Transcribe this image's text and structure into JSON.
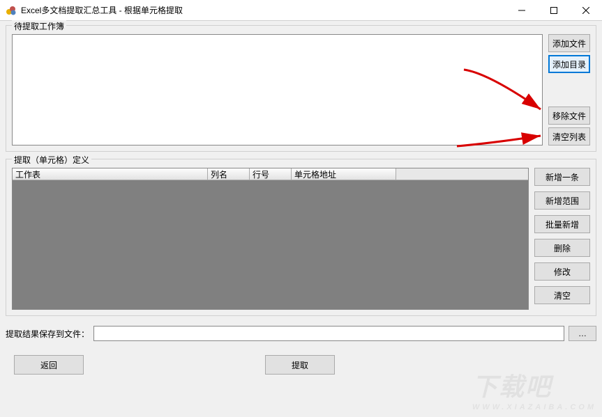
{
  "window": {
    "title": "Excel多文档提取汇总工具 - 根据单元格提取"
  },
  "group1": {
    "legend": "待提取工作簿",
    "buttons": {
      "add_file": "添加文件",
      "add_dir": "添加目录",
      "remove_file": "移除文件",
      "clear_list": "清空列表"
    }
  },
  "group2": {
    "legend": "提取（单元格）定义",
    "columns": {
      "c0": "工作表",
      "c1": "列名",
      "c2": "行号",
      "c3": "单元格地址"
    },
    "buttons": {
      "add_row": "新增一条",
      "add_range": "新增范围",
      "batch_add": "批量新增",
      "delete": "删除",
      "edit": "修改",
      "clear": "清空"
    }
  },
  "save": {
    "label": "提取结果保存到文件：",
    "value": "",
    "browse": "…"
  },
  "bottom": {
    "back": "返回",
    "extract": "提取"
  }
}
